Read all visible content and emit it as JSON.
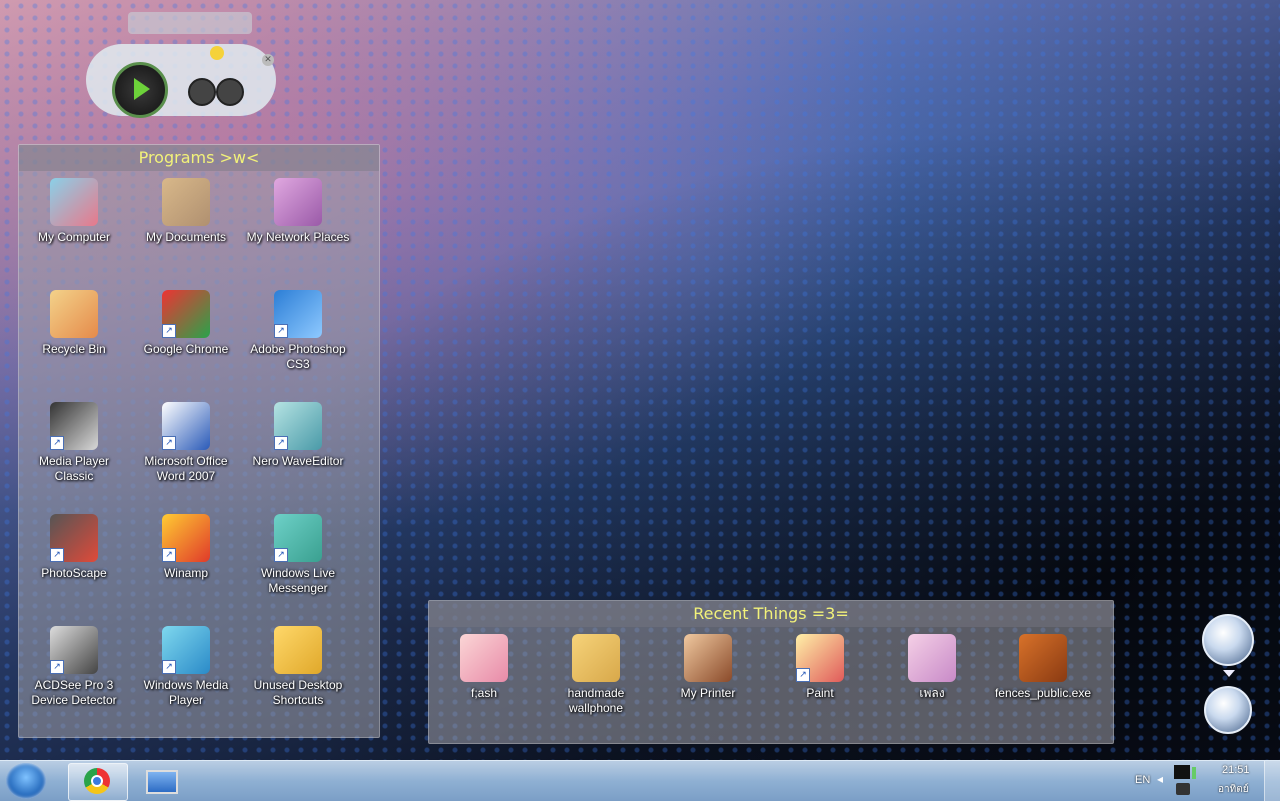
{
  "programs_fence": {
    "title": "Programs >w<",
    "items": [
      {
        "label": "My Computer",
        "icon": "my-computer-icon",
        "shortcut": false
      },
      {
        "label": "My Documents",
        "icon": "my-documents-icon",
        "shortcut": false
      },
      {
        "label": "My Network Places",
        "icon": "network-places-icon",
        "shortcut": false
      },
      {
        "label": "Recycle Bin",
        "icon": "recycle-bin-icon",
        "shortcut": false
      },
      {
        "label": "Google Chrome",
        "icon": "chrome-icon",
        "shortcut": true
      },
      {
        "label": "Adobe Photoshop CS3",
        "icon": "photoshop-icon",
        "shortcut": true
      },
      {
        "label": "Media Player Classic",
        "icon": "media-player-classic-icon",
        "shortcut": true
      },
      {
        "label": "Microsoft Office Word 2007",
        "icon": "word-icon",
        "shortcut": true
      },
      {
        "label": "Nero WaveEditor",
        "icon": "nero-waveeditor-icon",
        "shortcut": true
      },
      {
        "label": "PhotoScape",
        "icon": "photoscape-icon",
        "shortcut": true
      },
      {
        "label": "Winamp",
        "icon": "winamp-icon",
        "shortcut": true
      },
      {
        "label": "Windows Live Messenger",
        "icon": "messenger-icon",
        "shortcut": true
      },
      {
        "label": "ACDSee Pro 3 Device Detector",
        "icon": "acdsee-icon",
        "shortcut": true
      },
      {
        "label": "Windows Media Player",
        "icon": "windows-media-player-icon",
        "shortcut": true
      },
      {
        "label": "Unused Desktop Shortcuts",
        "icon": "unused-shortcuts-icon",
        "shortcut": false
      }
    ]
  },
  "recent_fence": {
    "title": "Recent Things =3=",
    "items": [
      {
        "label": "f;ash",
        "icon": "doll-icon",
        "shortcut": false
      },
      {
        "label": "handmade wallphone",
        "icon": "folder-icon",
        "shortcut": false
      },
      {
        "label": "My Printer",
        "icon": "printer-face-icon",
        "shortcut": false
      },
      {
        "label": "Paint",
        "icon": "paint-icon",
        "shortcut": true
      },
      {
        "label": "เพลง",
        "icon": "music-player-icon",
        "shortcut": false
      },
      {
        "label": "fences_public.exe",
        "icon": "fences-installer-icon",
        "shortcut": false
      }
    ]
  },
  "taskbar": {
    "pinned": [
      "chrome-icon",
      "computer-monitor-icon"
    ],
    "language": "EN",
    "time": "21:51",
    "day": "อาทิตย์"
  },
  "colors": {
    "fence_title": "#f2f27a",
    "taskbar": "#8fb0d3"
  }
}
